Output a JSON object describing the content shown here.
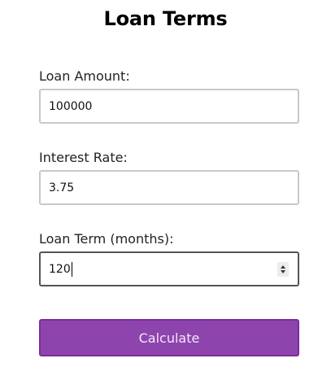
{
  "form": {
    "title": "Loan Terms",
    "loan_amount": {
      "label": "Loan Amount:",
      "value": "100000"
    },
    "interest_rate": {
      "label": "Interest Rate:",
      "value": "3.75"
    },
    "loan_term": {
      "label": "Loan Term (months):",
      "value": "120"
    },
    "calculate_label": "Calculate"
  },
  "colors": {
    "button_background": "#8e44ad",
    "button_border": "#7d2c9e",
    "input_border": "#c8c8c8",
    "focused_border": "#555555"
  },
  "icons": {
    "stepper": "number-stepper-arrows-icon"
  }
}
